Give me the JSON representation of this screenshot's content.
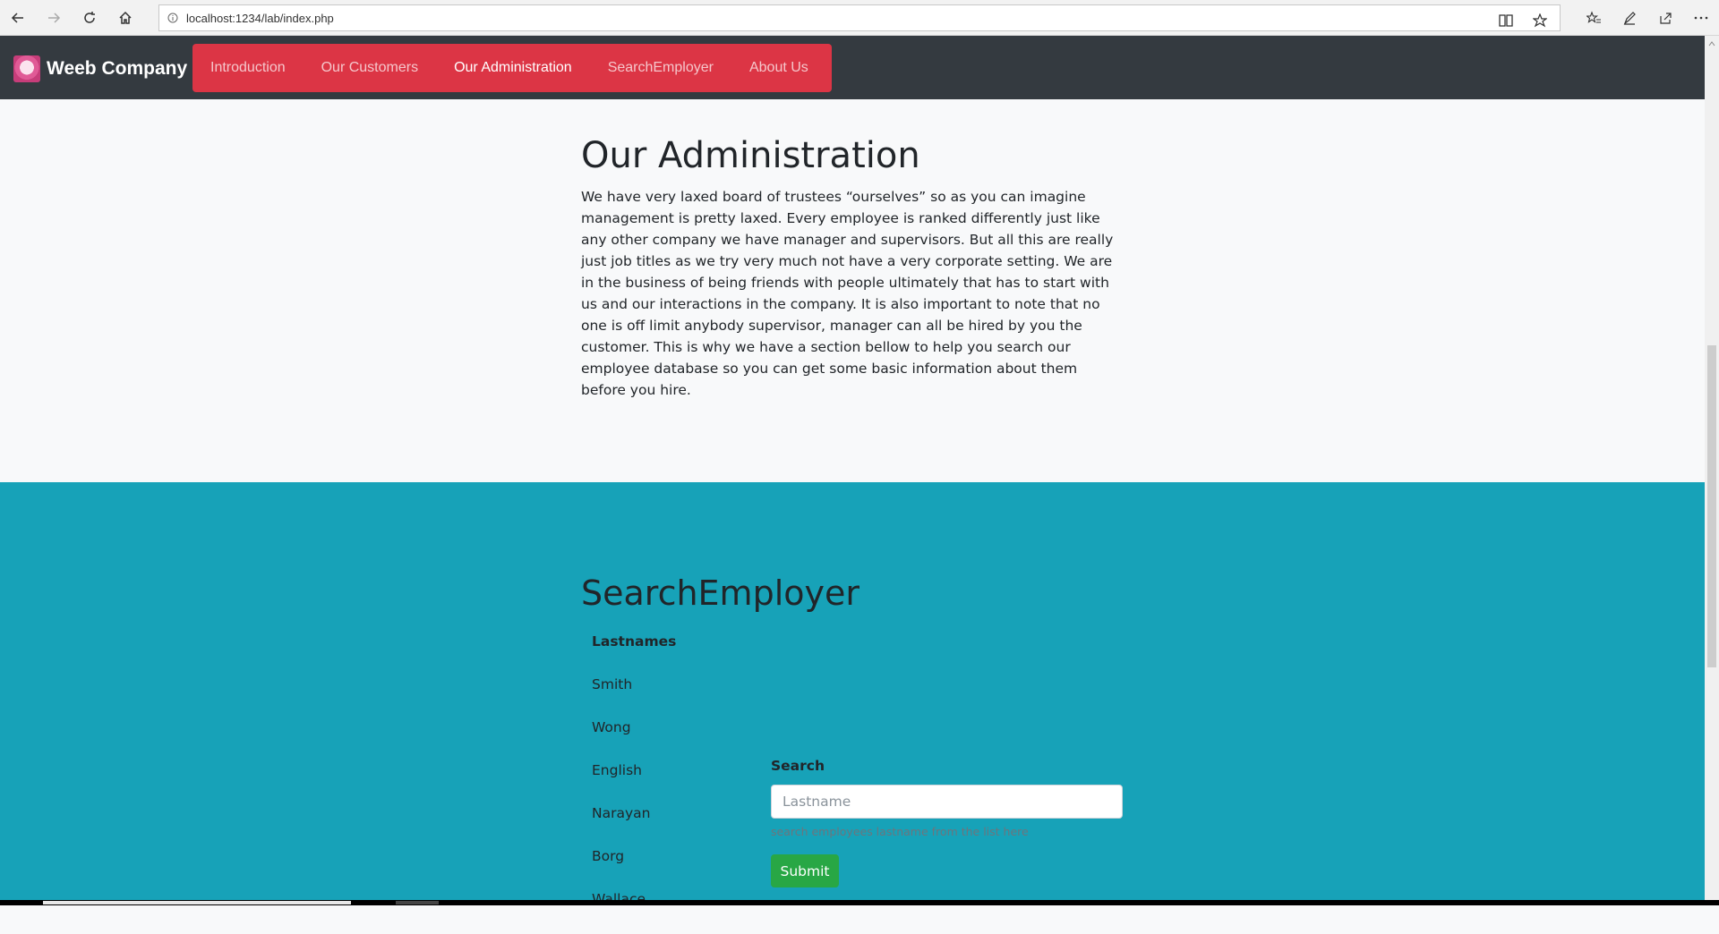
{
  "browser": {
    "url": "localhost:1234/lab/index.php"
  },
  "navbar": {
    "brand": "Weeb Company",
    "links": [
      {
        "label": "Introduction",
        "active": false
      },
      {
        "label": "Our Customers",
        "active": false
      },
      {
        "label": "Our Administration",
        "active": true
      },
      {
        "label": "SearchEmployer",
        "active": false
      },
      {
        "label": "About Us",
        "active": false
      }
    ]
  },
  "admin": {
    "title": "Our Administration",
    "body": "We have very laxed board of trustees “ourselves” so as you can imagine management is pretty laxed. Every employee is ranked differently just like any other company we have manager and supervisors. But all this are really just job titles as we try very much not have a very corporate setting. We are in the business of being friends with people ultimately that has to start with us and our interactions in the company. It is also important to note that no one is off limit anybody supervisor, manager can all be hired by you the customer. This is why we have a section bellow to help you search our employee database so you can get some basic information about them before you hire."
  },
  "search": {
    "title": "SearchEmployer",
    "list_header": "Lastnames",
    "lastnames": [
      "Smith",
      "Wong",
      "English",
      "Narayan",
      "Borg",
      "Wallace"
    ],
    "label": "Search",
    "placeholder": "Lastname",
    "help": "search employees lastname from the list here",
    "submit": "Submit"
  },
  "colors": {
    "navbar": "#343a40",
    "nav_accent": "#dc3545",
    "search_bg": "#17a2b8",
    "submit": "#28a745"
  }
}
